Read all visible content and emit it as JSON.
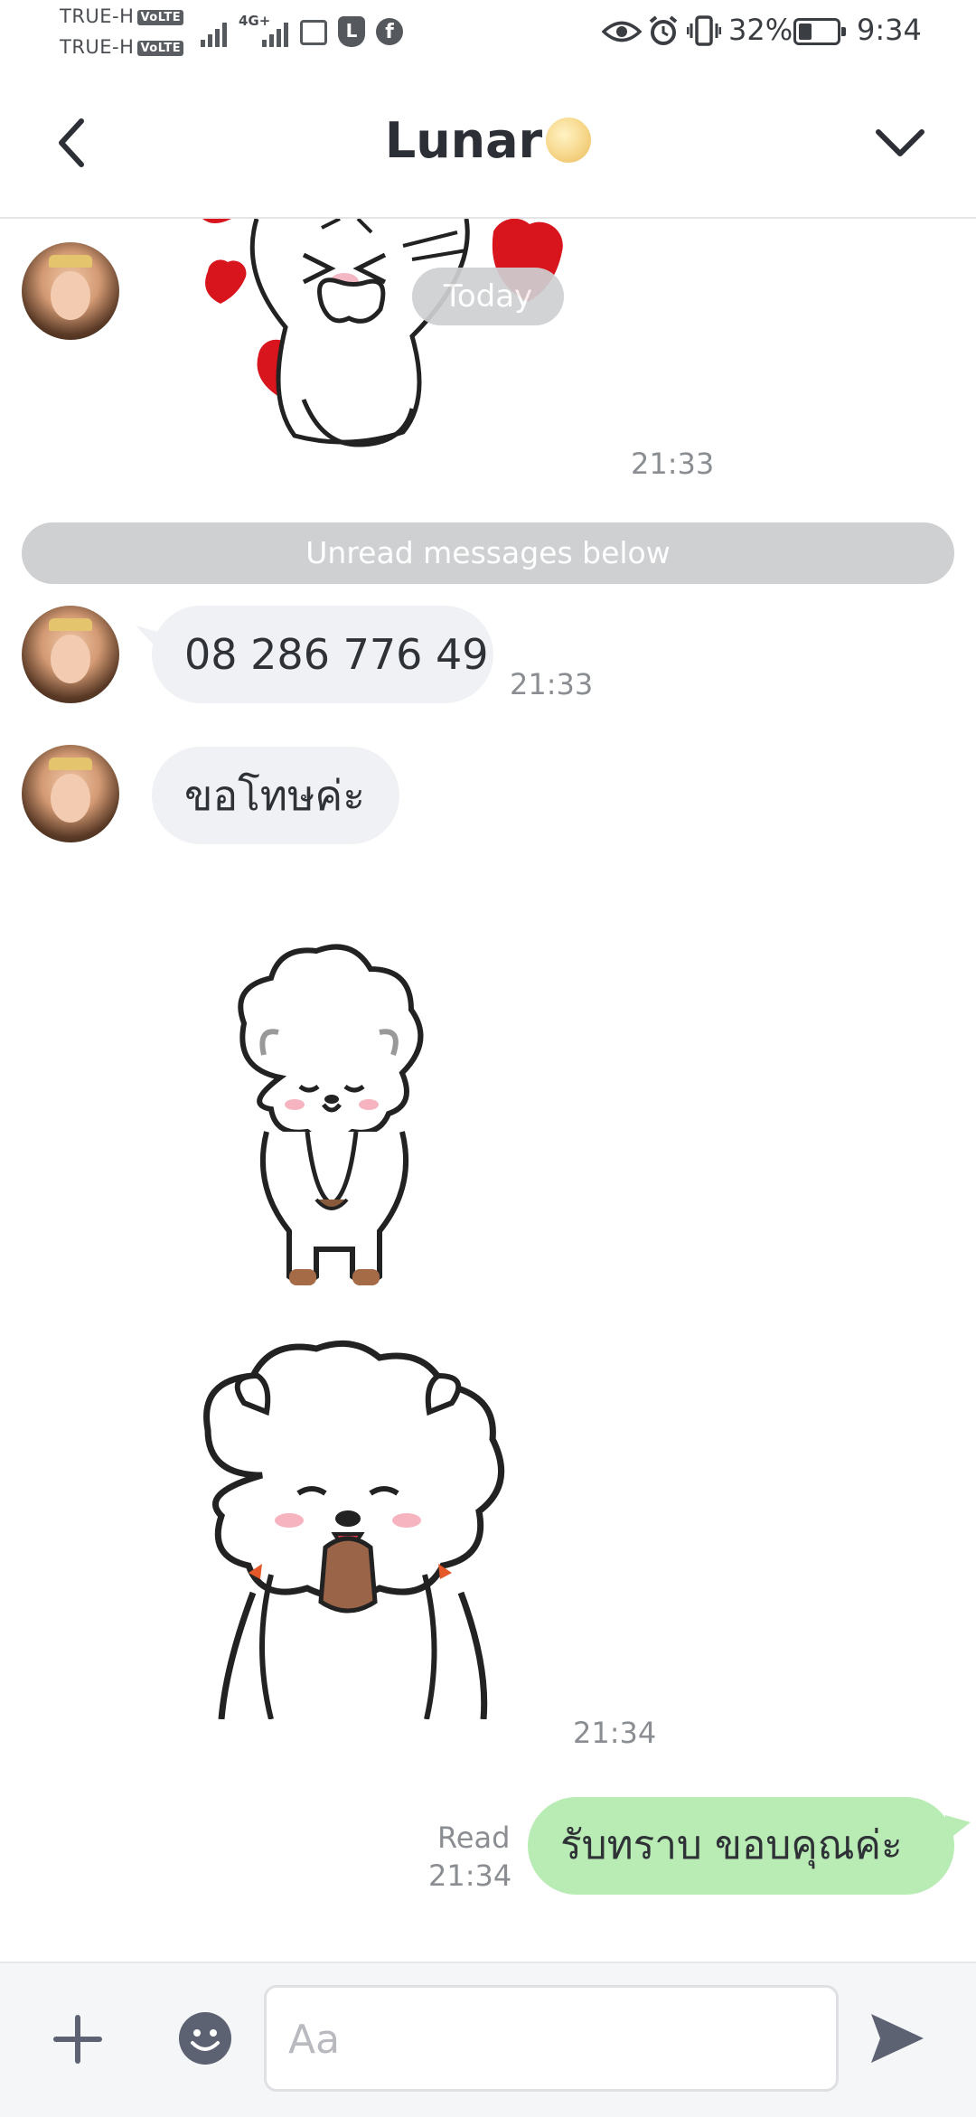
{
  "status_bar": {
    "carrier_1": "TRUE-H",
    "carrier_2": "TRUE-H",
    "volte_label": "VoLTE",
    "network_label": "4G+",
    "battery": "32%",
    "time": "9:34",
    "icons": [
      "signal-icon",
      "eye-icon",
      "alarm-icon",
      "vibrate-icon",
      "battery-icon",
      "facebook-icon",
      "line-icon"
    ]
  },
  "header": {
    "title": "Lunar",
    "back_icon": "chevron-left-icon",
    "menu_icon": "chevron-down-icon"
  },
  "chat": {
    "today_label": "Today",
    "unread_label": "Unread messages below",
    "messages": [
      {
        "type": "sticker",
        "direction": "in",
        "sticker": "cat-hearts-sticker",
        "time": "21:33"
      },
      {
        "type": "text",
        "direction": "in",
        "text": "08 286 776 49",
        "time": "21:33"
      },
      {
        "type": "text",
        "direction": "in",
        "text": "ขอโทษค่ะ"
      },
      {
        "type": "sticker",
        "direction": "in",
        "sticker": "sheep-bow-sticker"
      },
      {
        "type": "sticker",
        "direction": "in",
        "sticker": "sheep-pray-sticker",
        "time": "21:34"
      },
      {
        "type": "text",
        "direction": "out",
        "text": "รับทราบ ขอบคุณค่ะ",
        "read_label": "Read",
        "time": "21:34"
      }
    ]
  },
  "input_bar": {
    "placeholder": "Aa",
    "value": "",
    "add_icon": "plus-icon",
    "emoji_icon": "emoji-icon",
    "send_icon": "send-icon"
  },
  "colors": {
    "outgoing_bubble": "#b9ebb4",
    "incoming_bubble": "#f0f1f4",
    "pill": "#cfd0d2",
    "icon": "#5d6273"
  }
}
